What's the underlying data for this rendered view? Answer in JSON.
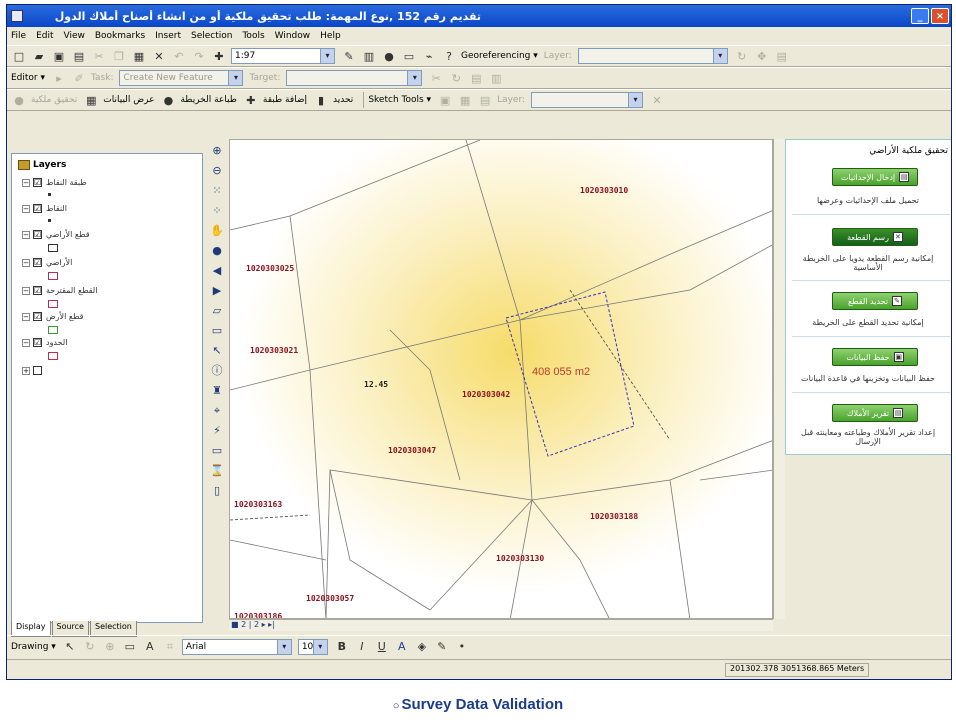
{
  "window": {
    "title": "تقديم رقم 152 ,نوع المهمة: طلب تحقيق ملكية أو من انشاء أصناح أملاك الدول",
    "minimize_icon": "minimize-icon",
    "close_icon": "close-icon"
  },
  "menu": [
    "File",
    "Edit",
    "View",
    "Bookmarks",
    "Insert",
    "Selection",
    "Tools",
    "Window",
    "Help"
  ],
  "toolbar1": {
    "scale": "1:97",
    "georef_label": "Georeferencing ▾",
    "layer_label": "Layer:"
  },
  "toolbar2": {
    "editor_label": "Editor ▾",
    "task_value": "Create New Feature",
    "target_label": "Target:"
  },
  "toolbar3": {
    "custom_buttons": [
      "تحقيق ملكية",
      "عرض البيانات",
      "طباعة الخريطة",
      "إضافة طبقة",
      "تحديد"
    ],
    "sketch_label": "Sketch Tools ▾",
    "layer_label": "Layer:"
  },
  "toc": {
    "root_label": "Layers",
    "layers": [
      {
        "label": "طبقة النقاط",
        "checked": "☑"
      },
      {
        "label": "النقاط",
        "checked": "☑"
      },
      {
        "label": "قطع الأراضي",
        "checked": "☑"
      },
      {
        "label": "الأراضي",
        "checked": "☑"
      },
      {
        "label": "القطع المقترحة",
        "checked": "☑"
      },
      {
        "label": "قطع الأرض",
        "checked": "☑"
      },
      {
        "label": "الحدود",
        "checked": "☑"
      }
    ],
    "tabs": [
      "Display",
      "Source",
      "Selection"
    ]
  },
  "map": {
    "area_label": "408 055 m2",
    "parcel_numbers": [
      "1020303010",
      "1020303025",
      "1020303021",
      "1020303042",
      "1020303047",
      "1020303163",
      "1020303188",
      "1020303130",
      "1020303057",
      "1020303186"
    ],
    "block_label": "12.45",
    "pager": "■ 2 | 2 ▸ ▸|"
  },
  "panel": {
    "title": "تحقيق ملكية الأراضي",
    "buttons": [
      {
        "label": "إدخال الإحداثيات",
        "desc": "تحميل ملف الإحداثيات وعرضها"
      },
      {
        "label": "رسم القطعة",
        "desc": "إمكانية رسم القطعة يدويا على الخريطة الأساسية"
      },
      {
        "label": "تحديد القطع",
        "desc": "إمكانية تحديد القطع على الخريطة"
      },
      {
        "label": "حفظ البيانات",
        "desc": "حفظ البيانات وتخزينها في قاعدة البيانات"
      },
      {
        "label": "تقرير الأملاك",
        "desc": "إعداد تقرير الأملاك وطباعته ومعاينته قبل الإرسال"
      }
    ]
  },
  "drawbar": {
    "drawing_label": "Drawing ▾",
    "font": "Arial",
    "font_size": "10",
    "bold": "B",
    "italic": "I",
    "underline": "U"
  },
  "status": {
    "coords": "201302.378  3051368.865 Meters"
  },
  "caption": {
    "bullet": "○",
    "text": "Survey Data Validation"
  }
}
